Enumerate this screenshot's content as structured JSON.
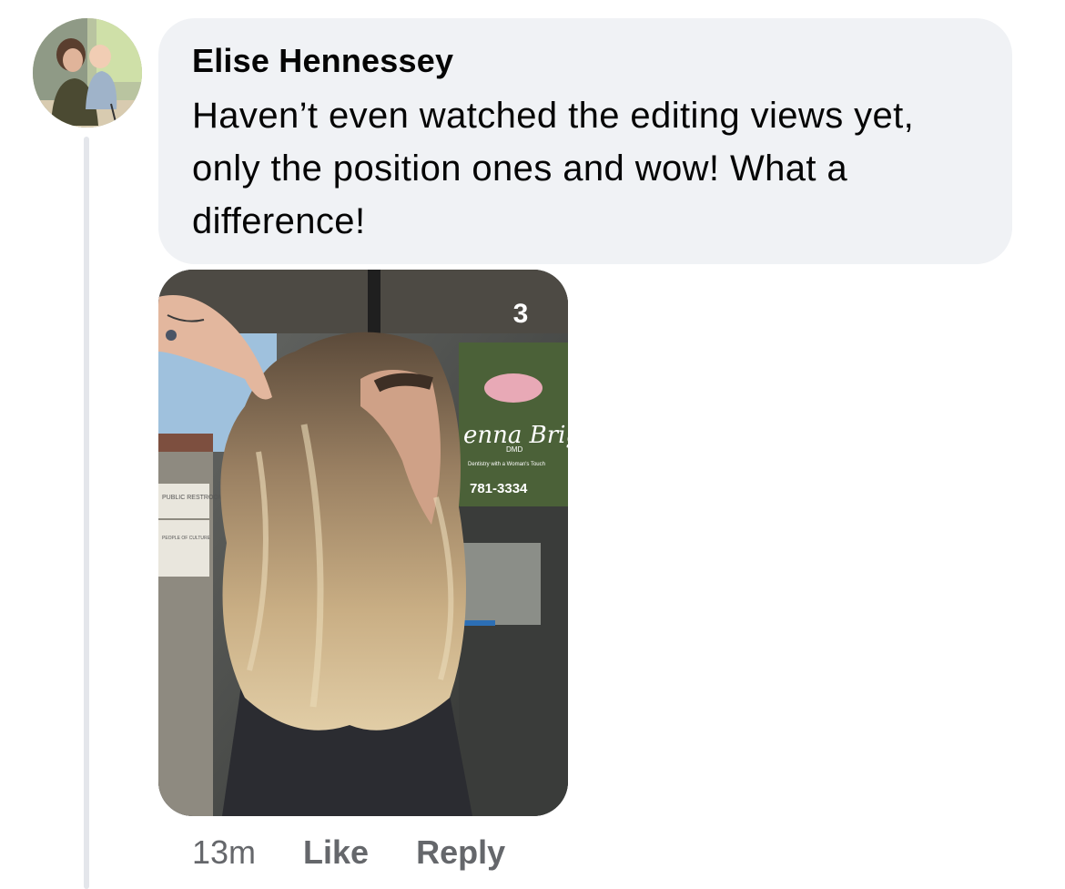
{
  "comment": {
    "author": "Elise Hennessey",
    "text": "Haven’t even watched the editing views yet, only the position ones and wow! What a difference!",
    "timestamp": "13m",
    "actions": {
      "like_label": "Like",
      "reply_label": "Reply"
    },
    "attachment": {
      "overlay_number": "3",
      "sign_script": "enna Brigh",
      "sign_subtext": "DMD",
      "sign_tagline": "Dentistry with a Woman's Touch",
      "sign_phone": "781-3334",
      "side_sign_top": "PUBLIC RESTROOMS",
      "side_sign_bottom": "PEOPLE OF CULTURE"
    }
  }
}
